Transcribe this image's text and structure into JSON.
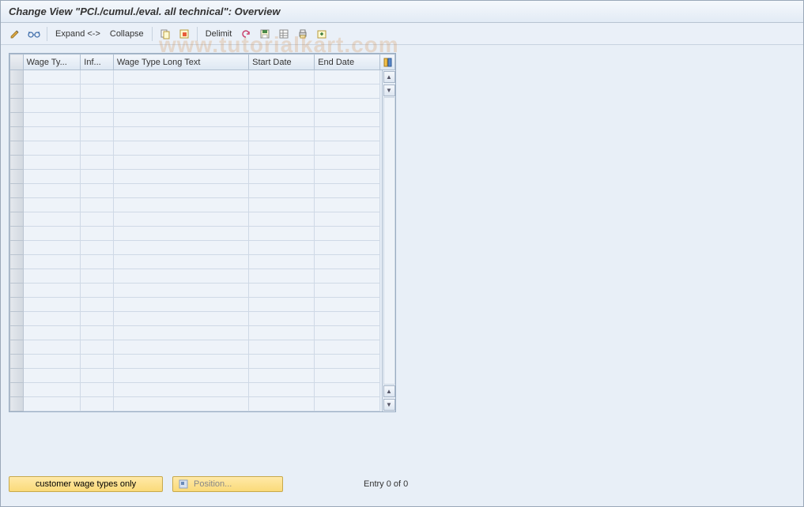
{
  "title": "Change View \"PCl./cumul./eval. all technical\": Overview",
  "toolbar": {
    "expand_label": "Expand <->",
    "collapse_label": "Collapse",
    "delimit_label": "Delimit"
  },
  "table": {
    "columns": [
      "Wage Ty...",
      "Inf...",
      "Wage Type Long Text",
      "Start Date",
      "End Date"
    ],
    "empty_rows": 24
  },
  "footer": {
    "customer_btn": "customer wage types only",
    "position_btn": "Position...",
    "entry_text": "Entry 0 of 0"
  },
  "watermark": "www.tutorialkart.com"
}
